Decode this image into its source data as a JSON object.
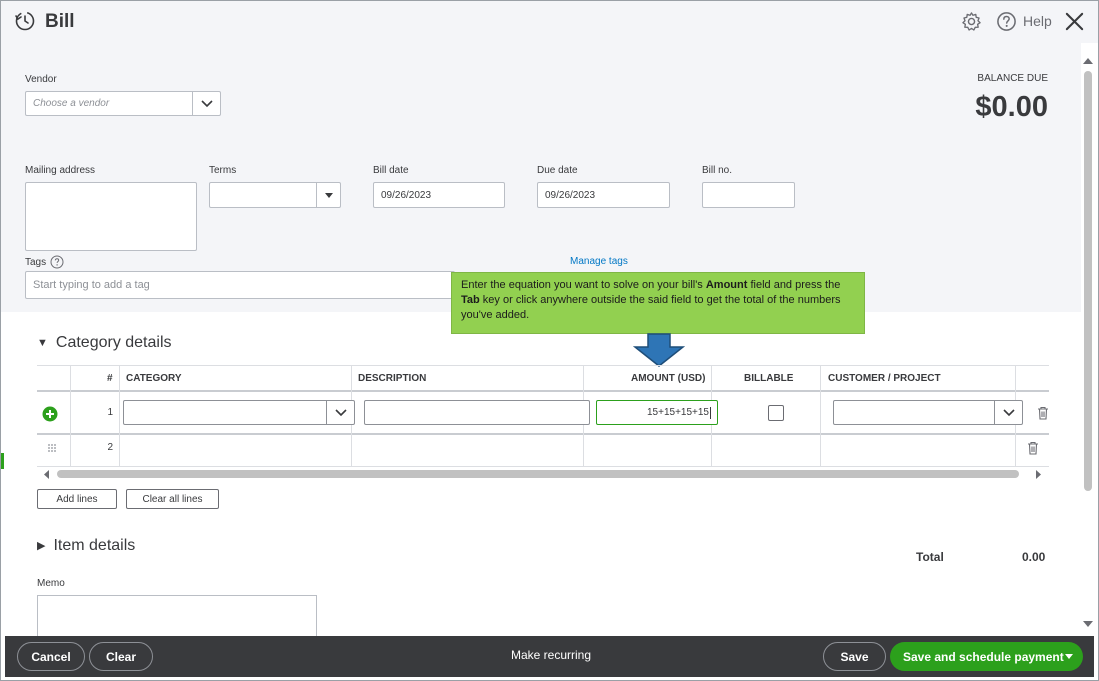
{
  "header": {
    "title": "Bill",
    "help_label": "Help"
  },
  "vendor": {
    "label": "Vendor",
    "placeholder": "Choose a vendor"
  },
  "balance": {
    "label": "BALANCE DUE",
    "amount": "$0.00"
  },
  "fields": {
    "mailing_address_label": "Mailing address",
    "terms_label": "Terms",
    "bill_date_label": "Bill date",
    "bill_date_value": "09/26/2023",
    "due_date_label": "Due date",
    "due_date_value": "09/26/2023",
    "bill_no_label": "Bill no."
  },
  "tags": {
    "label": "Tags",
    "manage_link": "Manage tags",
    "placeholder": "Start typing to add a tag"
  },
  "tooltip": {
    "part1": "Enter the equation you want to solve on your bill's ",
    "bold1": "Amount",
    "part2": " field and press the ",
    "bold2": "Tab",
    "part3": " key or click anywhere outside the said field to get the total of the numbers you've added."
  },
  "category": {
    "title": "Category details",
    "columns": {
      "num": "#",
      "category": "CATEGORY",
      "description": "DESCRIPTION",
      "amount": "AMOUNT (USD)",
      "billable": "BILLABLE",
      "customer": "CUSTOMER / PROJECT"
    },
    "rows": [
      {
        "num": "1",
        "amount": "15+15+15+15"
      },
      {
        "num": "2"
      }
    ],
    "add_lines": "Add lines",
    "clear_all_lines": "Clear all lines"
  },
  "item": {
    "title": "Item details"
  },
  "total": {
    "label": "Total",
    "value": "0.00"
  },
  "memo": {
    "label": "Memo"
  },
  "footer": {
    "cancel": "Cancel",
    "clear": "Clear",
    "make_recurring": "Make recurring",
    "save": "Save",
    "save_schedule": "Save and schedule payment"
  },
  "colors": {
    "accent_green": "#2ca01c",
    "tooltip_green": "#92d050",
    "link_blue": "#0077c5",
    "footer_dark": "#393a3d"
  }
}
